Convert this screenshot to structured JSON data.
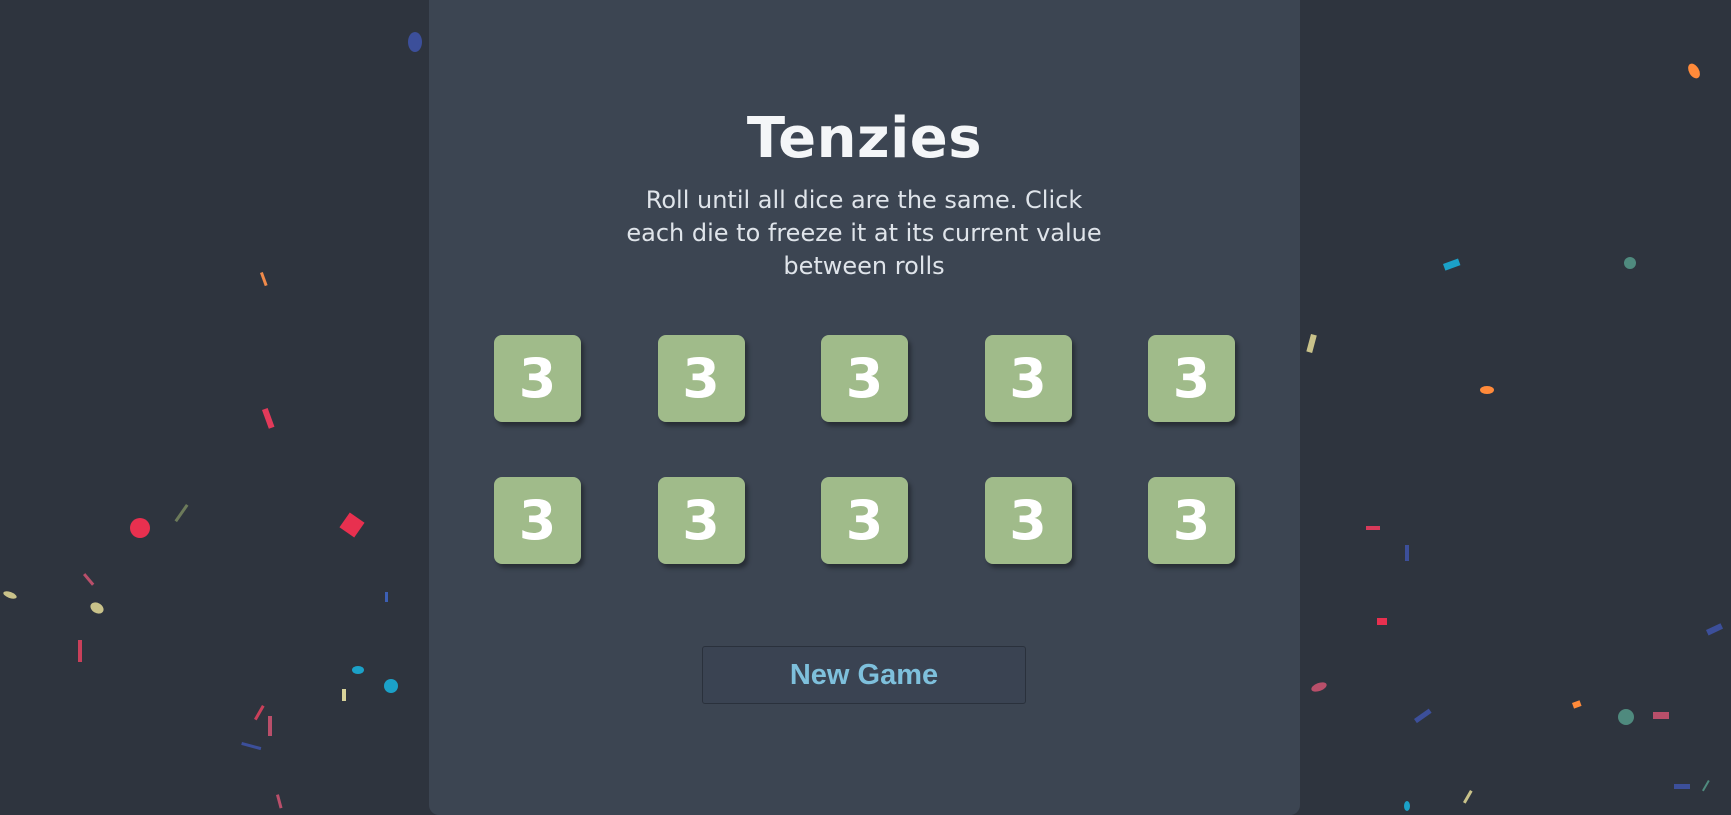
{
  "game": {
    "title": "Tenzies",
    "instructions": "Roll until all dice are the same. Click each die to freeze it at its current value between rolls",
    "dice": [
      "3",
      "3",
      "3",
      "3",
      "3",
      "3",
      "3",
      "3",
      "3",
      "3"
    ],
    "button_label": "New Game"
  },
  "colors": {
    "background": "#2e343e",
    "panel": "#3c4552",
    "die_held": "#a0bb8a",
    "button_text": "#7ec0dc"
  }
}
